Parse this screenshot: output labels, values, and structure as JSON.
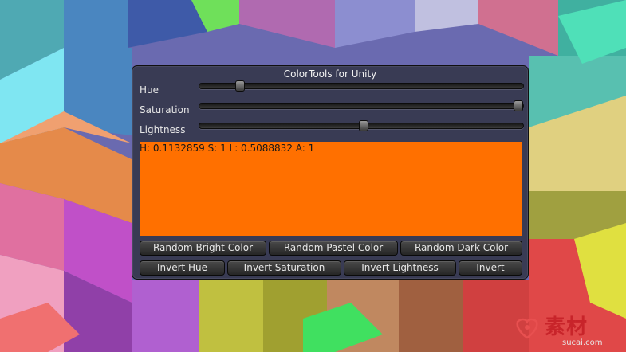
{
  "window": {
    "title": "ColorTools for Unity"
  },
  "sliders": [
    {
      "label": "Hue",
      "value": 0.1132859
    },
    {
      "label": "Saturation",
      "value": 1
    },
    {
      "label": "Lightness",
      "value": 0.5088832
    }
  ],
  "swatch": {
    "color": "#ff7000",
    "readout": "H: 0.1132859 S: 1 L: 0.5088832 A: 1"
  },
  "buttons": {
    "random_bright": "Random Bright Color",
    "random_pastel": "Random Pastel Color",
    "random_dark": "Random Dark Color",
    "invert_hue": "Invert Hue",
    "invert_saturation": "Invert Saturation",
    "invert_lightness": "Invert Lightness",
    "invert": "Invert"
  },
  "colors": {
    "panel_bg": "#1c1e1c",
    "button_top": "#4a4a4a",
    "button_bottom": "#262626",
    "watermark_red": "#c8242a"
  },
  "watermark": {
    "brand": "素材",
    "url": "sucai.com"
  }
}
